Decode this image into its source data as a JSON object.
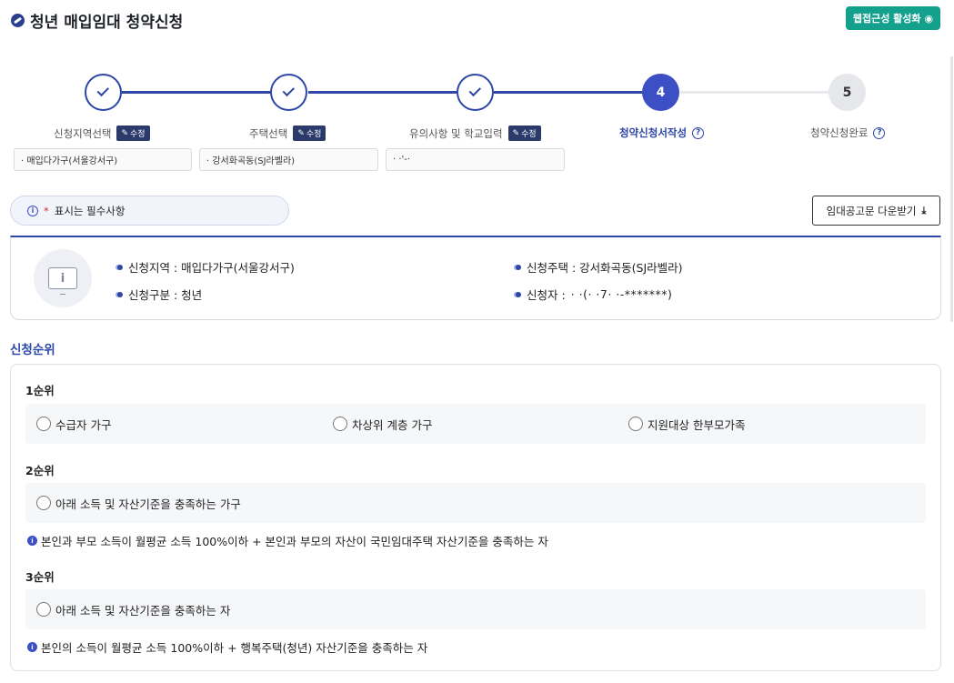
{
  "header": {
    "title": "청년 매입임대 청약신청",
    "access_button": "웹접근성 활성화"
  },
  "stepper": {
    "steps": [
      {
        "number": "",
        "label": "신청지역선택",
        "state": "done",
        "edit": "수정",
        "summary": "· 매입다가구(서울강서구)"
      },
      {
        "number": "",
        "label": "주택선택",
        "state": "done",
        "edit": "수정",
        "summary": "· 강서화곡동(SJ라벨라)"
      },
      {
        "number": "",
        "label": "유의사항 및 학교입력",
        "state": "done",
        "edit": "수정",
        "summary": "· ·'-·"
      },
      {
        "number": "4",
        "label": "청약신청서작성",
        "state": "active",
        "help": "?"
      },
      {
        "number": "5",
        "label": "청약신청완료",
        "state": "todo",
        "help": "?"
      }
    ]
  },
  "notice": {
    "asterisk": "*",
    "text": "표시는 필수사항"
  },
  "download_button": "임대공고문 다운받기",
  "applicant": {
    "region_label": "신청지역 : 매입다가구(서울강서구)",
    "house_label": "신청주택 : 강서화곡동(SJ라벨라)",
    "type_label": "신청구분 : 청년",
    "applicant_prefix": "신청자 :",
    "applicant_masked": "  ·  ·(·  ·7·    ·-*******)"
  },
  "ranking": {
    "title": "신청순위",
    "rank1": {
      "title": "1순위",
      "options": [
        "수급자 가구",
        "차상위 계층 가구",
        "지원대상 한부모가족"
      ]
    },
    "rank2": {
      "title": "2순위",
      "option": "아래 소득 및 자산기준을 충족하는 가구",
      "note": "본인과 부모 소득이 월평균 소득 100%이하 + 본인과 부모의 자산이 국민임대주택 자산기준을 충족하는 자"
    },
    "rank3": {
      "title": "3순위",
      "option": "아래 소득 및 자산기준을 충족하는 자",
      "note": "본인의 소득이 월평균 소득 100%이하 + 행복주택(청년) 자산기준을 충족하는 자"
    }
  },
  "colors": {
    "primary": "#2d47a8",
    "active_step": "#3c4fc4",
    "access_button": "#13a08d",
    "edit_badge": "#2b3a6b"
  }
}
